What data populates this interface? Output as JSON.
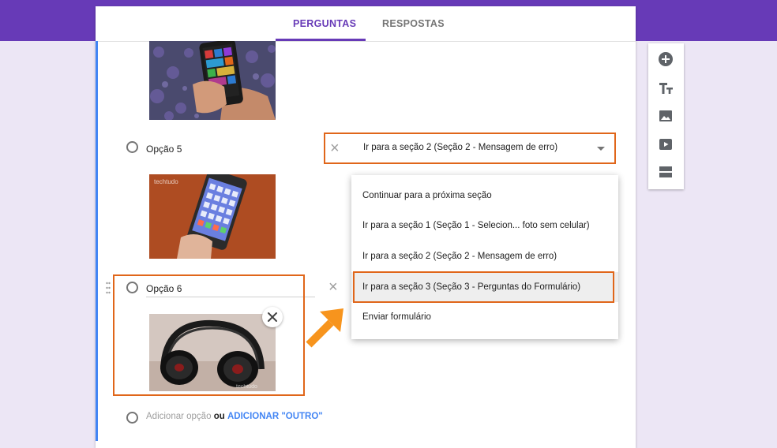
{
  "tabs": {
    "questions": "PERGUNTAS",
    "responses": "RESPOSTAS"
  },
  "options": [
    {
      "label": "Opção 5"
    },
    {
      "label": "Opção 6"
    }
  ],
  "dropdown": {
    "selected": "Ir para a seção 2 (Seção 2 - Mensagem de erro)"
  },
  "menu": {
    "items": [
      "Continuar para a próxima seção",
      "Ir para a seção 1 (Seção 1 - Selecion... foto sem celular)",
      "Ir para a seção 2 (Seção 2 - Mensagem de erro)",
      "Ir para a seção 3 (Seção 3 - Perguntas do Formulário)",
      "Enviar formulário"
    ],
    "selected_index": 3
  },
  "add_option": {
    "placeholder": "Adicionar opção",
    "or": "ou",
    "other_link": "ADICIONAR \"OUTRO\""
  },
  "image_watermark": "techtudo",
  "icons": {
    "sidebar": [
      "add-question-icon",
      "title-text-icon",
      "image-icon",
      "video-icon",
      "section-icon"
    ]
  },
  "colors": {
    "brand": "#673ab7",
    "highlight": "#e0661a",
    "link": "#4285f4",
    "arrow": "#f7941d"
  }
}
